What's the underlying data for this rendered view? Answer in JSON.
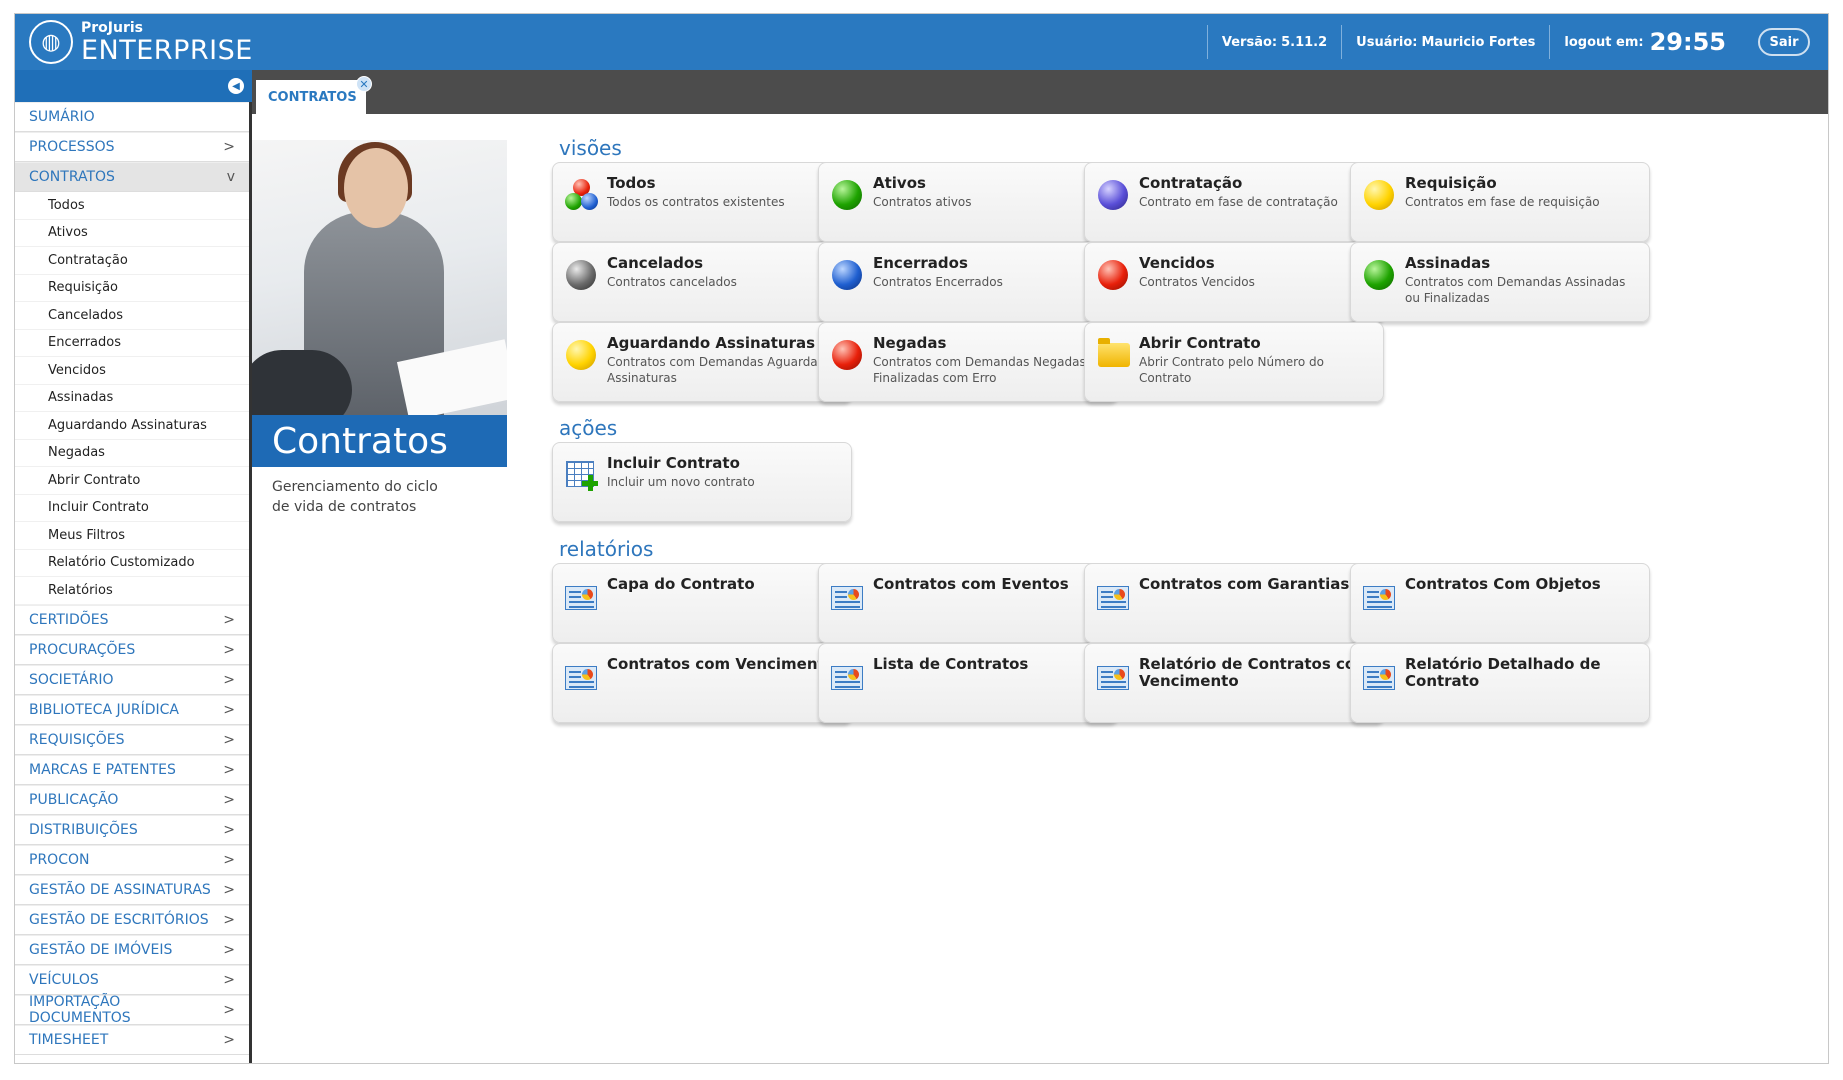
{
  "header": {
    "logo_small": "ProJuris",
    "logo_big": "ENTERPRISE",
    "version_label": "Versão:",
    "version_value": "5.11.2",
    "user_label": "Usuário:",
    "user_value": "Mauricio Fortes",
    "logout_label": "logout em:",
    "logout_timer": "29:55",
    "exit_button": "Sair"
  },
  "tab": {
    "label": "CONTRATOS"
  },
  "sidebar": {
    "sections_before": [
      {
        "label": "SUMÁRIO",
        "chevron": ""
      },
      {
        "label": "PROCESSOS",
        "chevron": ">"
      }
    ],
    "open_section": {
      "label": "CONTRATOS",
      "chevron": "v"
    },
    "sub_items": [
      "Todos",
      "Ativos",
      "Contratação",
      "Requisição",
      "Cancelados",
      "Encerrados",
      "Vencidos",
      "Assinadas",
      "Aguardando Assinaturas",
      "Negadas",
      "Abrir Contrato",
      "Incluir Contrato",
      "Meus Filtros",
      "Relatório Customizado",
      "Relatórios"
    ],
    "sections_after": [
      "CERTIDÕES",
      "PROCURAÇÕES",
      "SOCIETÁRIO",
      "BIBLIOTECA JURÍDICA",
      "REQUISIÇÕES",
      "MARCAS E PATENTES",
      "PUBLICAÇÃO",
      "DISTRIBUIÇÕES",
      "PROCON",
      "GESTÃO DE ASSINATURAS",
      "GESTÃO DE ESCRITÓRIOS",
      "GESTÃO DE IMÓVEIS",
      "VEÍCULOS",
      "IMPORTAÇÃO DOCUMENTOS",
      "TIMESHEET"
    ],
    "chevron": ">"
  },
  "hero": {
    "title": "Contratos",
    "description": "Gerenciamento do ciclo de vida de contratos"
  },
  "visoes": {
    "title": "visões",
    "cards": [
      {
        "title": "Todos",
        "desc": "Todos os contratos existentes",
        "icon": "multi-color-balls-icon"
      },
      {
        "title": "Ativos",
        "desc": "Contratos ativos",
        "icon": "green-ball-icon"
      },
      {
        "title": "Contratação",
        "desc": "Contrato em fase de contratação",
        "icon": "purple-ball-icon"
      },
      {
        "title": "Requisição",
        "desc": "Contratos em fase de requisição",
        "icon": "yellow-ball-icon"
      },
      {
        "title": "Cancelados",
        "desc": "Contratos cancelados",
        "icon": "gray-ball-icon"
      },
      {
        "title": "Encerrados",
        "desc": "Contratos Encerrados",
        "icon": "blue-ball-icon"
      },
      {
        "title": "Vencidos",
        "desc": "Contratos Vencidos",
        "icon": "red-ball-icon"
      },
      {
        "title": "Assinadas",
        "desc": "Contratos com Demandas Assinadas ou Finalizadas",
        "icon": "green-ball-icon"
      },
      {
        "title": "Aguardando Assinaturas",
        "desc": "Contratos com Demandas Aguardando Assinaturas",
        "icon": "yellow-ball-icon"
      },
      {
        "title": "Negadas",
        "desc": "Contratos com Demandas Negadas ou Finalizadas com Erro",
        "icon": "red-ball-icon"
      },
      {
        "title": "Abrir Contrato",
        "desc": "Abrir Contrato pelo Número do Contrato",
        "icon": "folder-icon"
      }
    ]
  },
  "acoes": {
    "title": "ações",
    "cards": [
      {
        "title": "Incluir Contrato",
        "desc": "Incluir um novo contrato",
        "icon": "add-table-icon"
      }
    ]
  },
  "relatorios": {
    "title": "relatórios",
    "cards": [
      {
        "title": "Capa do Contrato",
        "icon": "report-icon"
      },
      {
        "title": "Contratos com Eventos",
        "icon": "report-icon"
      },
      {
        "title": "Contratos com Garantias",
        "icon": "report-icon"
      },
      {
        "title": "Contratos Com Objetos",
        "icon": "report-icon"
      },
      {
        "title": "Contratos com Vencimento",
        "icon": "report-icon"
      },
      {
        "title": "Lista de Contratos",
        "icon": "report-icon"
      },
      {
        "title": "Relatório de Contratos com Vencimento",
        "icon": "report-icon"
      },
      {
        "title": "Relatório Detalhado de Contrato",
        "icon": "report-icon"
      }
    ]
  },
  "colors": {
    "header_blue": "#2a79c0",
    "link_blue": "#2e76bc",
    "hero_blue": "#1e6ab5"
  }
}
